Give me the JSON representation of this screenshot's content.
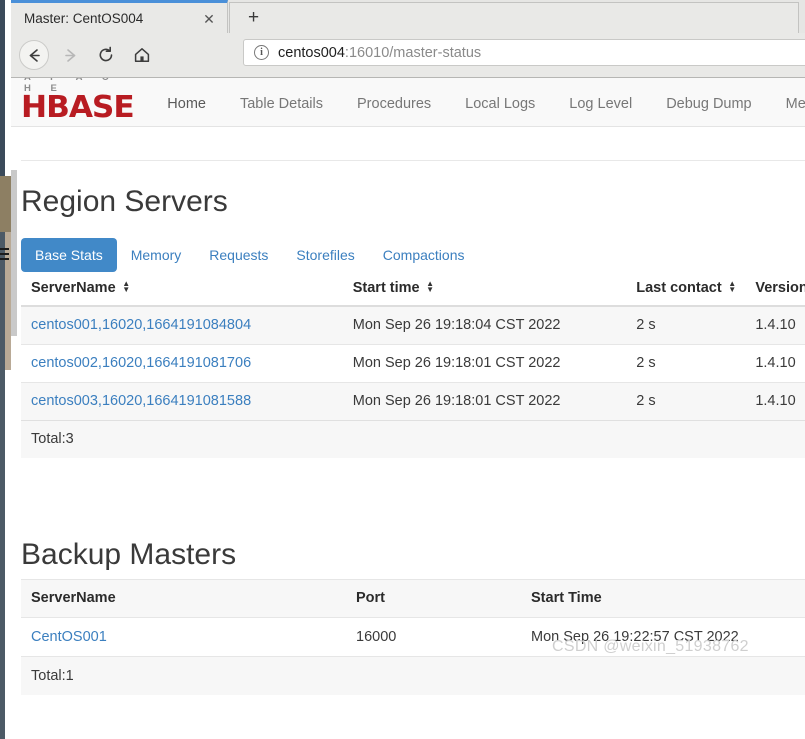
{
  "browser": {
    "tab_title": "Master: CentOS004",
    "close_icon": "close-icon",
    "newtab_icon": "plus-icon",
    "back_icon": "arrow-left-icon",
    "forward_icon": "arrow-right-icon",
    "reload_icon": "reload-icon",
    "home_icon": "home-icon",
    "url_info_icon": "info-icon",
    "url_host": "centos004",
    "url_path": ":16010/master-status"
  },
  "navbar": {
    "brand_top": "A P A C H E",
    "brand_main": "HBASE",
    "brand_color": "#b81c22",
    "links": [
      {
        "label": "Home"
      },
      {
        "label": "Table Details"
      },
      {
        "label": "Procedures"
      },
      {
        "label": "Local Logs"
      },
      {
        "label": "Log Level"
      },
      {
        "label": "Debug Dump"
      },
      {
        "label": "Metrics"
      }
    ]
  },
  "region_servers": {
    "title": "Region Servers",
    "accent_color": "#4189c8",
    "tabs": [
      {
        "label": "Base Stats",
        "active": true
      },
      {
        "label": "Memory",
        "active": false
      },
      {
        "label": "Requests",
        "active": false
      },
      {
        "label": "Storefiles",
        "active": false
      },
      {
        "label": "Compactions",
        "active": false
      }
    ],
    "columns": [
      "ServerName",
      "Start time",
      "Last contact",
      "Version"
    ],
    "rows": [
      {
        "server_name": "centos001,16020,1664191084804",
        "start_time": "Mon Sep 26 19:18:04 CST 2022",
        "last_contact": "2 s",
        "version": "1.4.10"
      },
      {
        "server_name": "centos002,16020,1664191081706",
        "start_time": "Mon Sep 26 19:18:01 CST 2022",
        "last_contact": "2 s",
        "version": "1.4.10"
      },
      {
        "server_name": "centos003,16020,1664191081588",
        "start_time": "Mon Sep 26 19:18:01 CST 2022",
        "last_contact": "2 s",
        "version": "1.4.10"
      }
    ],
    "total": "Total:3"
  },
  "backup_masters": {
    "title": "Backup Masters",
    "columns": [
      "ServerName",
      "Port",
      "Start Time"
    ],
    "rows": [
      {
        "server_name": "CentOS001",
        "port": "16000",
        "start_time": "Mon Sep 26 19:22:57 CST 2022"
      }
    ],
    "total": "Total:1"
  },
  "watermark": "CSDN @weixin_51938762"
}
